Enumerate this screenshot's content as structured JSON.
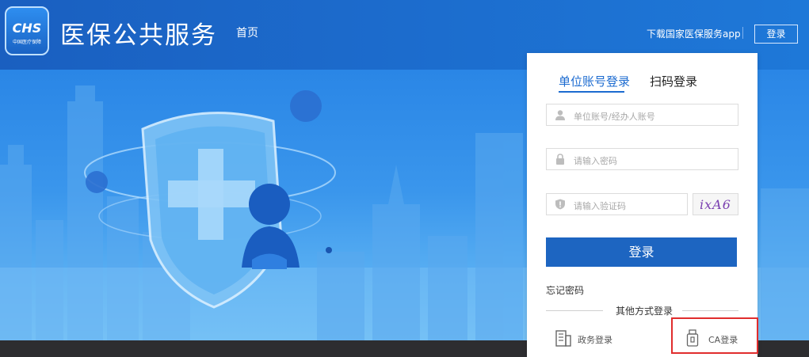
{
  "header": {
    "logo_text": "CHS",
    "logo_sub": "中国医疗保障",
    "title": "医保公共服务",
    "nav_home": "首页",
    "download_app": "下载国家医保服务app",
    "login_button": "登录"
  },
  "login_panel": {
    "tabs": [
      {
        "label": "单位账号登录",
        "active": true
      },
      {
        "label": "扫码登录",
        "active": false
      }
    ],
    "account_placeholder": "单位账号/经办人账号",
    "password_placeholder": "请输入密码",
    "captcha_placeholder": "请输入验证码",
    "captcha_text": "ixA6",
    "submit_label": "登录",
    "forgot_password": "忘记密码",
    "other_methods": "其他方式登录",
    "alt_logins": [
      {
        "label": "政务登录",
        "icon": "building-icon"
      },
      {
        "label": "CA登录",
        "icon": "usb-key-icon"
      }
    ]
  },
  "colors": {
    "brand_blue": "#1d65c1",
    "active_tab": "#1c6bd0",
    "highlight_red": "#e02d2d"
  }
}
